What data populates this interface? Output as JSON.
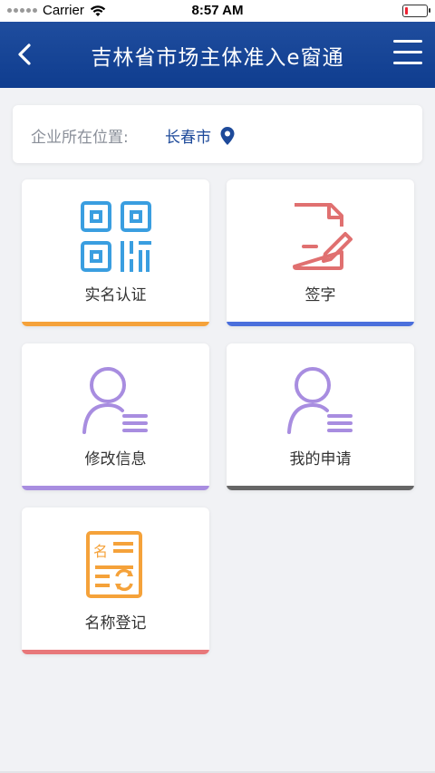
{
  "status_bar": {
    "carrier": "Carrier",
    "time": "8:57 AM"
  },
  "header": {
    "title": "吉林省市场主体准入e窗通"
  },
  "location": {
    "label": "企业所在位置:",
    "city": "长春市"
  },
  "tiles": [
    {
      "label": "实名认证",
      "icon": "qr-code-icon",
      "accent": "#f5a23a"
    },
    {
      "label": "签字",
      "icon": "sign-document-icon",
      "accent": "#4a6fdc"
    },
    {
      "label": "修改信息",
      "icon": "user-edit-icon",
      "accent": "#a88de0"
    },
    {
      "label": "我的申请",
      "icon": "user-list-icon",
      "accent": "#666666"
    },
    {
      "label": "名称登记",
      "icon": "name-register-icon",
      "accent": "#e8787a"
    }
  ],
  "colors": {
    "header": "#1a4a9c",
    "background": "#f1f2f5"
  }
}
